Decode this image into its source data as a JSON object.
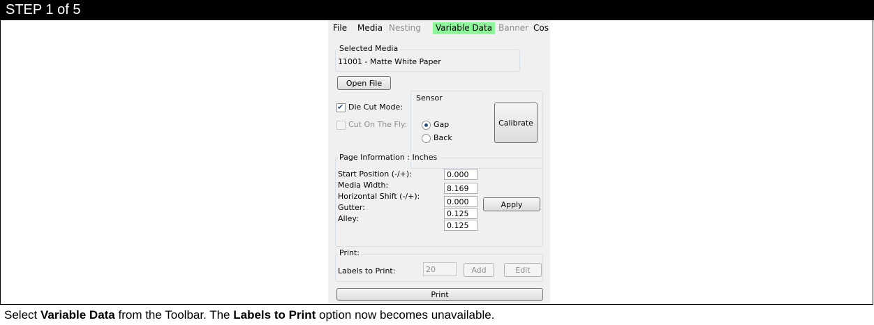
{
  "header": {
    "title": "STEP 1 of 5"
  },
  "caption": {
    "part1": "Select ",
    "bold1": "Variable Data",
    "part2": " from the Toolbar. The ",
    "bold2": "Labels to Print",
    "part3": " option now becomes unavailable."
  },
  "menu": {
    "items": [
      {
        "label": "File",
        "state": "normal"
      },
      {
        "label": "Media",
        "state": "normal"
      },
      {
        "label": "Nesting",
        "state": "disabled"
      },
      {
        "label": "Variable Data",
        "state": "active"
      },
      {
        "label": "Banner",
        "state": "disabled"
      },
      {
        "label": "Cos",
        "state": "normal"
      }
    ],
    "active_color": "#8ef59a"
  },
  "selected_media": {
    "title": "Selected Media",
    "value": "11001 - Matte White Paper"
  },
  "open_file_label": "Open File",
  "die_cut": {
    "label": "Die Cut Mode:",
    "checked": true
  },
  "cut_on_fly": {
    "label": "Cut On The Fly:",
    "checked": false,
    "disabled": true
  },
  "sensor": {
    "title": "Sensor",
    "options": [
      {
        "label": "Gap",
        "selected": true
      },
      {
        "label": "Back",
        "selected": false
      }
    ],
    "calibrate_label": "Calibrate"
  },
  "page_info": {
    "title": "Page Information : Inches",
    "fields": [
      {
        "label": "Start Position (-/+):",
        "value": "0.000"
      },
      {
        "label": "Media Width:",
        "value": "8.169"
      },
      {
        "label": "Horizontal Shift (-/+):",
        "value": "0.000"
      },
      {
        "label": "Gutter:",
        "value": "0.125"
      },
      {
        "label": "Alley:",
        "value": "0.125"
      }
    ],
    "apply_label": "Apply"
  },
  "print_group": {
    "title": "Print:",
    "labels_label": "Labels to Print:",
    "labels_value": "20",
    "add_label": "Add",
    "edit_label": "Edit"
  },
  "print_button_label": "Print"
}
